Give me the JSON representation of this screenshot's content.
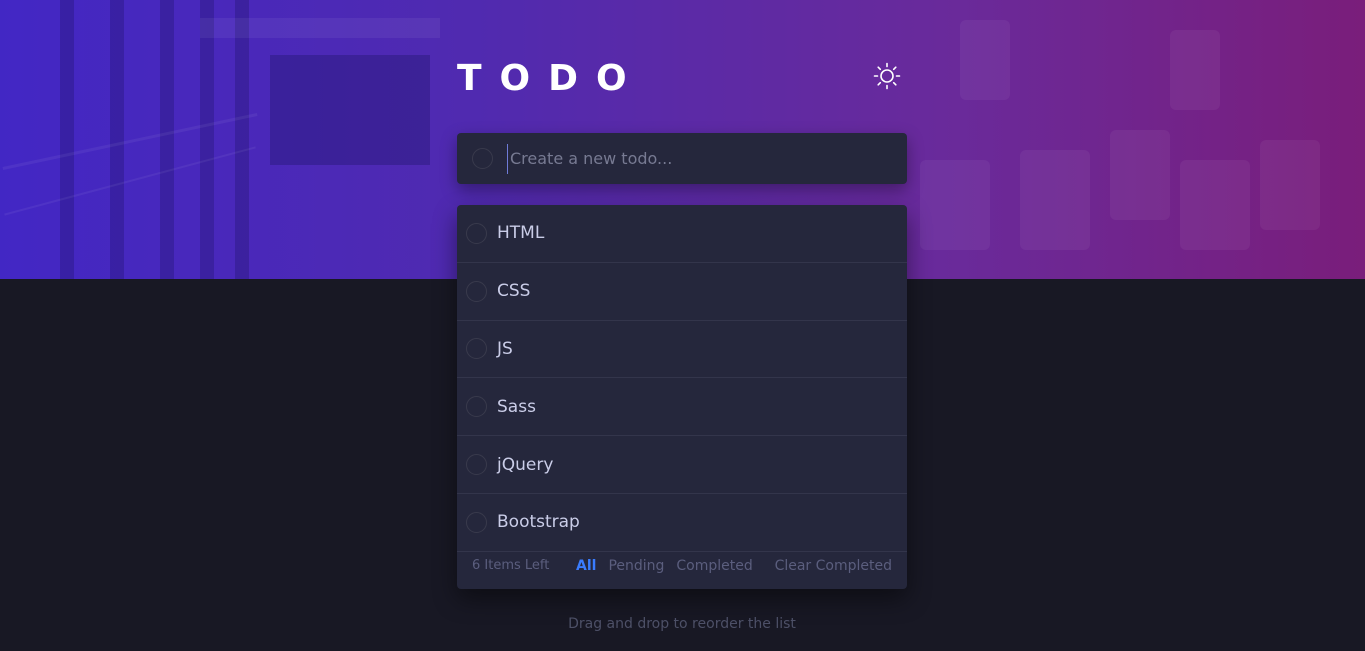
{
  "header": {
    "title": "TODO",
    "theme_icon": "sun-icon"
  },
  "create": {
    "placeholder": "Create a new todo..."
  },
  "todos": [
    {
      "label": "HTML",
      "completed": false
    },
    {
      "label": "CSS",
      "completed": false
    },
    {
      "label": "JS",
      "completed": false
    },
    {
      "label": "Sass",
      "completed": false
    },
    {
      "label": "jQuery",
      "completed": false
    },
    {
      "label": "Bootstrap",
      "completed": false
    }
  ],
  "footer": {
    "count": "6 Items Left",
    "filters": [
      "All",
      "Pending",
      "Completed"
    ],
    "active_filter": "All",
    "clear_label": "Clear Completed"
  },
  "hint": "Drag and drop to reorder the list",
  "colors": {
    "accent": "#3a7cfd",
    "card": "#25273c",
    "background": "#181824",
    "hero_start": "#4628d2",
    "hero_end": "#821e82"
  }
}
